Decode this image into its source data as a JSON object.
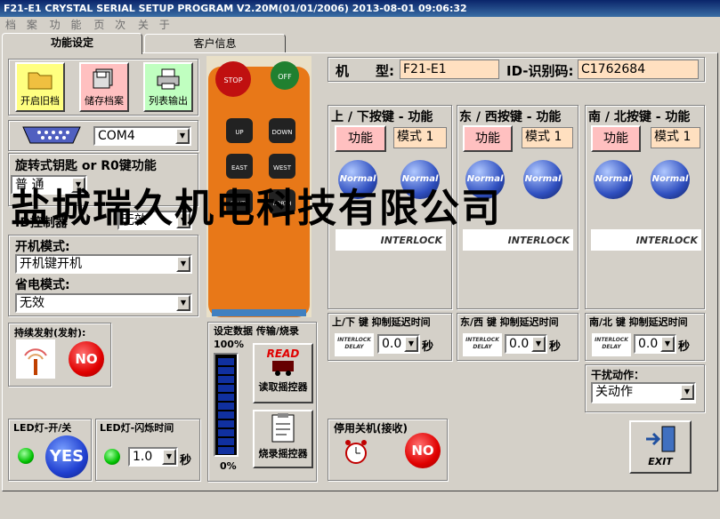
{
  "window": {
    "title": "F21-E1 CRYSTAL SERIAL SETUP PROGRAM V2.20M(01/01/2006)  2013-08-01  09:06:32"
  },
  "menu": [
    "档 案",
    "功 能",
    "页 次",
    "关 于"
  ],
  "tabs": [
    "功能设定",
    "客户信息"
  ],
  "toolbar": {
    "open_label": "开启旧档",
    "save_label": "储存档案",
    "print_label": "列表输出"
  },
  "port": {
    "value": "COM4"
  },
  "key_function": {
    "label": "旋转式钥匙 or R0键功能",
    "value": "普 通"
  },
  "id_control": {
    "label": "ID控制器",
    "value": "无效"
  },
  "power_on": {
    "label": "开机模式:",
    "value": "开机键开机"
  },
  "power_save": {
    "label": "省电模式:",
    "value": "无效"
  },
  "continuous": {
    "label": "持续发射(发射):",
    "button": "NO"
  },
  "led_onoff": {
    "label": "LED灯-开/关",
    "button": "YES"
  },
  "led_blink": {
    "label": "LED灯-闪烁时间",
    "value": "1.0",
    "unit": "秒"
  },
  "transfer": {
    "label": "设定数据 传输/烧录",
    "top_pct": "100%",
    "bottom_pct": "0%",
    "read_label": "读取摇控器",
    "read_icon_text": "READ",
    "burn_label": "烧录摇控器"
  },
  "remote": {
    "stop": "STOP",
    "off": "OFF",
    "up": "UP",
    "down": "DOWN",
    "east": "EAST",
    "west": "WEST",
    "south": "SOUTH",
    "north": "NORTH"
  },
  "model": {
    "label": "机　　型:",
    "value": "F21-E1",
    "id_label": "ID-识别码:",
    "id_value": "C1762684"
  },
  "groups": [
    {
      "title": "上 / 下按键 - 功能",
      "func": "功能",
      "mode": "模式 1",
      "delay_title": "上/下 键 抑制延迟时间",
      "delay": "0.0"
    },
    {
      "title": "东 / 西按键 - 功能",
      "func": "功能",
      "mode": "模式 1",
      "delay_title": "东/西 键 抑制延迟时间",
      "delay": "0.0"
    },
    {
      "title": "南 / 北按键 - 功能",
      "func": "功能",
      "mode": "模式 1",
      "delay_title": "南/北 键 抑制延迟时间",
      "delay": "0.0"
    }
  ],
  "normal_text": "Normal",
  "interlock_text": "INTERLOCK",
  "interlock_delay_text": "INTERLOCK DELAY",
  "sec_unit": "秒",
  "interference": {
    "label": "干扰动作：",
    "value": "关动作"
  },
  "shutdown": {
    "label": "停用关机(接收)",
    "button": "NO"
  },
  "exit_label": "EXIT",
  "watermark": "盐城瑞久机电科技有限公司"
}
